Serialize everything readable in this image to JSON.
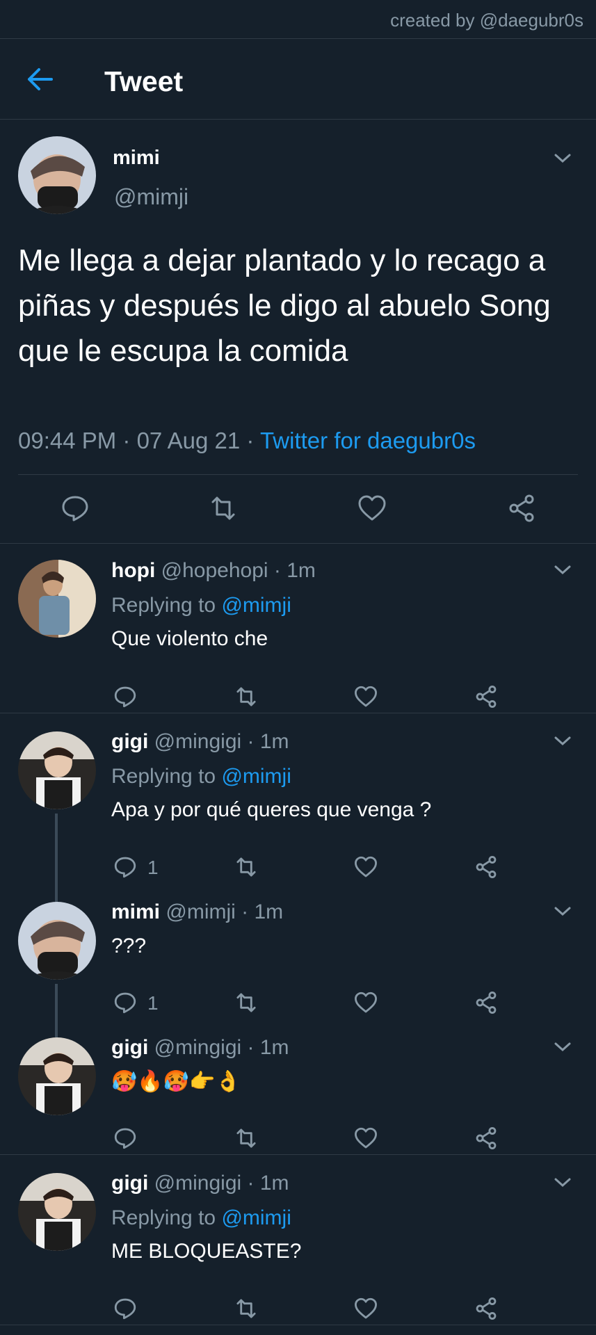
{
  "credit": "created by @daegubr0s",
  "header": {
    "title": "Tweet"
  },
  "tweet": {
    "name": "mimi",
    "handle": "@mimji",
    "text": "Me llega a dejar plantado y lo recago a piñas y después le digo al abuelo Song que le escupa la comida",
    "time": "09:44 PM",
    "date": "07 Aug 21",
    "source": "Twitter for daegubr0s",
    "actions": [
      "reply-icon",
      "retweet-icon",
      "like-icon",
      "share-icon"
    ]
  },
  "replies": [
    {
      "name": "hopi",
      "handle": "@hopehopi",
      "time": "1m",
      "replying_label": "Replying to",
      "replying_to": "@mimji",
      "text": "Que violento che",
      "reply_count": ""
    },
    {
      "name": "gigi",
      "handle": "@mingigi",
      "time": "1m",
      "replying_label": "Replying to",
      "replying_to": "@mimji",
      "text": "Apa y por qué queres que venga ?",
      "reply_count": "1"
    },
    {
      "name": "mimi",
      "handle": "@mimji",
      "time": "1m",
      "text": "???",
      "reply_count": "1"
    },
    {
      "name": "gigi",
      "handle": "@mingigi",
      "time": "1m",
      "text": "🥵🔥🥵👉👌",
      "reply_count": ""
    },
    {
      "name": "gigi",
      "handle": "@mingigi",
      "time": "1m",
      "replying_label": "Replying to",
      "replying_to": "@mimji",
      "text": "ME BLOQUEASTE?",
      "reply_count": ""
    }
  ],
  "colors": {
    "background": "#15202b",
    "accent": "#1d9bf0",
    "secondary_text": "#8899a6",
    "divider": "#2f3a45"
  }
}
